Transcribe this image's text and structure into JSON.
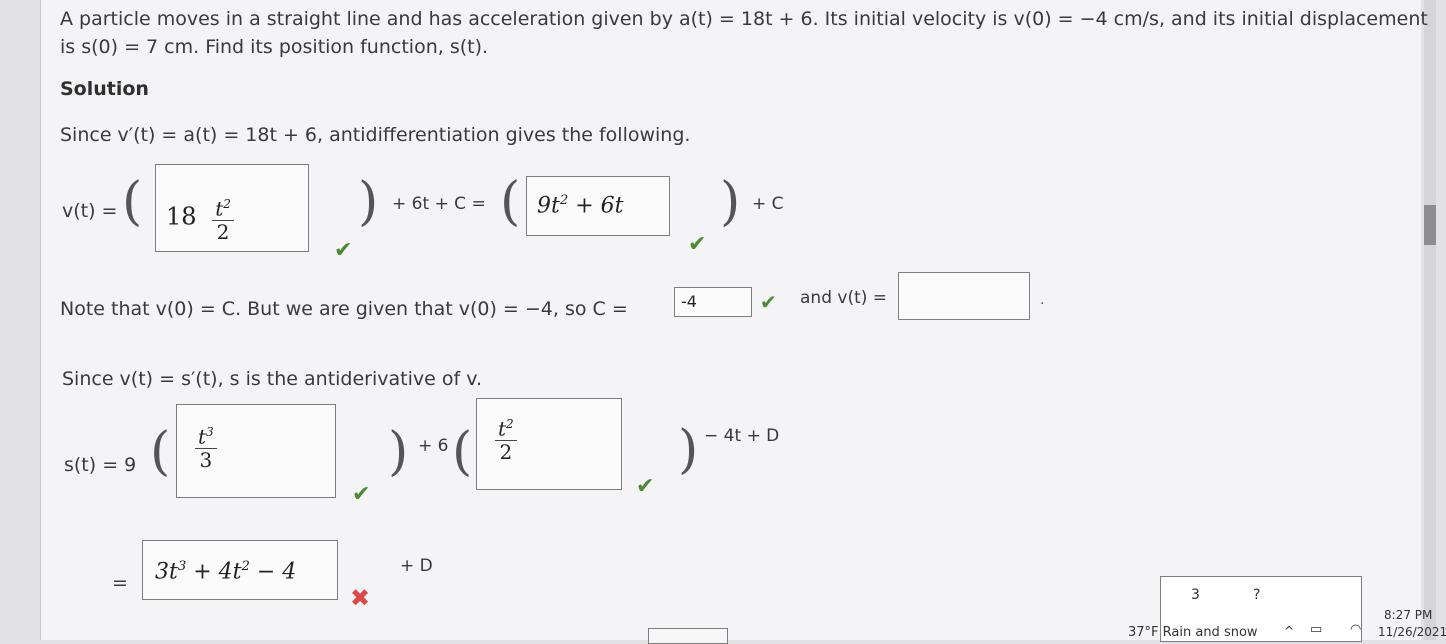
{
  "problem": {
    "line1": "A particle moves in a straight line and has acceleration given by a(t) = 18t + 6. Its initial velocity is v(0) = −4 cm/s, and its initial displacement",
    "line2": "is s(0) = 7 cm. Find its position function, s(t)."
  },
  "solution_heading": "Solution",
  "since_line": "Since v′(t) = a(t) = 18t + 6, antidifferentiation gives the following.",
  "v_section": {
    "label": "v(t) =",
    "box1_coef": "18",
    "box1_num": "t",
    "box1_num_exp": "2",
    "box1_den": "2",
    "plus_text": "+ 6t + C =",
    "box2_text": "9t",
    "box2_exp": "2",
    "box2_tail": " + 6t",
    "plus_c": "+ C"
  },
  "note_line": {
    "text": "Note that v(0) = C. But we are given that v(0) = −4, so C =",
    "c_value": "-4",
    "and_text": "and v(t) =",
    "vt_value": ""
  },
  "since_s_line": "Since v(t) = s′(t), s is the antiderivative of v.",
  "s_section": {
    "label": "s(t) = 9",
    "box1_num": "t",
    "box1_num_exp": "3",
    "box1_den": "3",
    "plus6": "+ 6",
    "box2_num": "t",
    "box2_num_exp": "2",
    "box2_den": "2",
    "tail": "− 4t + D"
  },
  "answer": {
    "equals": "=",
    "text": "3t",
    "exp1": "3",
    "mid": " + 4t",
    "exp2": "2",
    "tail": " − 4",
    "plus_d": "+ D"
  },
  "taskbar": {
    "weather": "37°F Rain and snow",
    "time": "8:27 PM",
    "date": "11/26/2021",
    "popup_a": "3",
    "popup_b": "?"
  },
  "colors": {
    "check": "#4a8a32",
    "cross": "#d84a4a",
    "background": "#f4f3f5"
  }
}
